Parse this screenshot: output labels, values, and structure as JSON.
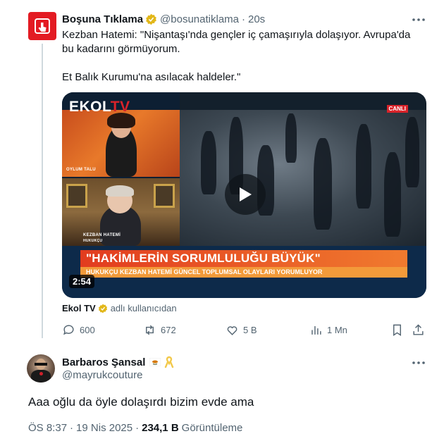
{
  "parent_tweet": {
    "author_name": "Boşuna Tıklama",
    "handle": "@bosunatiklama",
    "separator": "·",
    "time": "20s",
    "lines": [
      "Kezban Hatemi: \"Nişantaşı'nda gençler iç çamaşırıyla dolaşıyor. Avrupa'da",
      "bu kadarını görmüyorum.",
      "Et Balık Kurumu'na asılacak haldeler.\""
    ],
    "video": {
      "logo_main": "EKOL",
      "logo_tv": "TV",
      "live_badge": "CANLI",
      "guest1_caption": "OYLUM TALU",
      "guest2_caption": "KEZBAN HATEMİ",
      "guest2_role": "HUKUKÇU",
      "banner_title": "\"HAKİMLERİN SORUMLULUĞU BÜYÜK\"",
      "banner_sub": "HUKUKÇU KEZBAN HATEMİ GÜNCEL TOPLUMSAL OLAYLARI YORUMLUYOR",
      "duration": "2:54"
    },
    "attribution": {
      "account": "Ekol TV",
      "suffix": "adlı kullanıcıdan"
    },
    "actions": {
      "replies": "600",
      "reposts": "672",
      "likes": "5 B",
      "views": "1 Mn"
    }
  },
  "reply_tweet": {
    "author_name": "Barbaros Şansal",
    "handle": "@mayrukcouture",
    "text": "Aaa oğlu da öyle dolaşırdı bizim evde ama",
    "time": "ÖS 8:37",
    "date": "19 Nis 2025",
    "views_count": "234,1 B",
    "views_label": "Görüntüleme",
    "separator": "·"
  },
  "colors": {
    "text_primary": "#0f1419",
    "text_secondary": "#536471",
    "verified_gold": "#e2b719",
    "thread_line": "#cfd9de"
  }
}
